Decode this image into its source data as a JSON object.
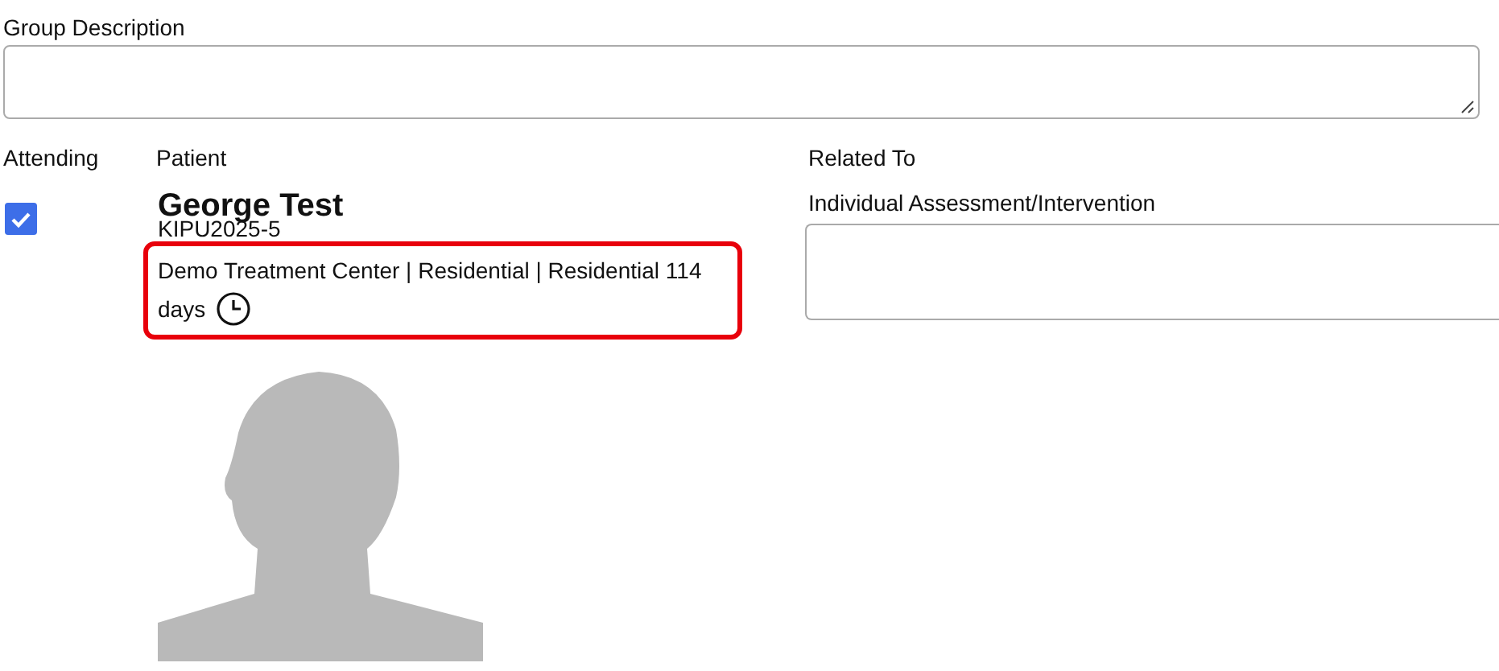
{
  "group_description": {
    "label": "Group Description"
  },
  "columns": {
    "attending": "Attending",
    "patient": "Patient",
    "related_to": "Related To"
  },
  "patient": {
    "attending": true,
    "name": "George Test",
    "id": "KIPU2025-5",
    "details": [
      "Demo Treatment Center | Residential | Residential 114",
      "days"
    ],
    "highlighted": true,
    "photo": {
      "kind": "silhouette"
    }
  },
  "related": {
    "label": "Individual Assessment/Intervention"
  }
}
